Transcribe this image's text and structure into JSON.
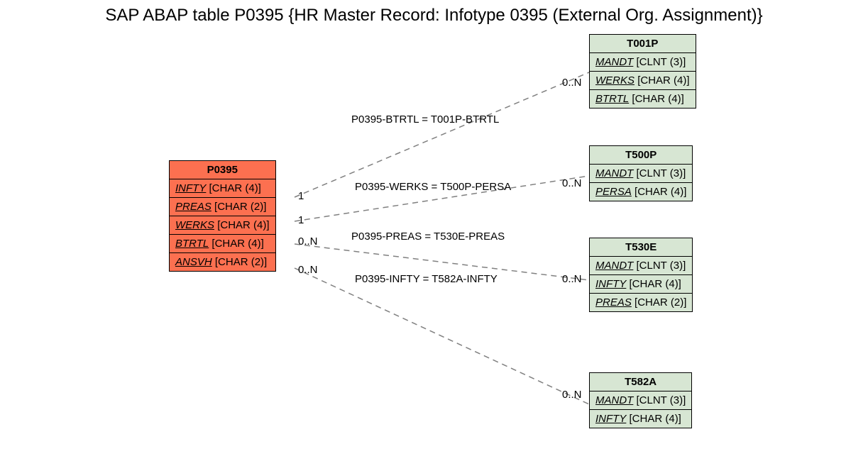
{
  "title": "SAP ABAP table P0395 {HR Master Record: Infotype 0395 (External Org. Assignment)}",
  "main": {
    "name": "P0395",
    "fields": [
      {
        "name": "INFTY",
        "type": "[CHAR (4)]"
      },
      {
        "name": "PREAS",
        "type": "[CHAR (2)]"
      },
      {
        "name": "WERKS",
        "type": "[CHAR (4)]"
      },
      {
        "name": "BTRTL",
        "type": "[CHAR (4)]"
      },
      {
        "name": "ANSVH",
        "type": "[CHAR (2)]"
      }
    ]
  },
  "refs": [
    {
      "name": "T001P",
      "fields": [
        {
          "name": "MANDT",
          "type": "[CLNT (3)]"
        },
        {
          "name": "WERKS",
          "type": "[CHAR (4)]"
        },
        {
          "name": "BTRTL",
          "type": "[CHAR (4)]"
        }
      ]
    },
    {
      "name": "T500P",
      "fields": [
        {
          "name": "MANDT",
          "type": "[CLNT (3)]"
        },
        {
          "name": "PERSA",
          "type": "[CHAR (4)]"
        }
      ]
    },
    {
      "name": "T530E",
      "fields": [
        {
          "name": "MANDT",
          "type": "[CLNT (3)]"
        },
        {
          "name": "INFTY",
          "type": "[CHAR (4)]"
        },
        {
          "name": "PREAS",
          "type": "[CHAR (2)]"
        }
      ]
    },
    {
      "name": "T582A",
      "fields": [
        {
          "name": "MANDT",
          "type": "[CLNT (3)]"
        },
        {
          "name": "INFTY",
          "type": "[CHAR (4)]"
        }
      ]
    }
  ],
  "relations": [
    {
      "label": "P0395-BTRTL = T001P-BTRTL",
      "card_left": "1",
      "card_right": "0..N"
    },
    {
      "label": "P0395-WERKS = T500P-PERSA",
      "card_left": "1",
      "card_right": "0..N"
    },
    {
      "label": "P0395-PREAS = T530E-PREAS",
      "card_left": "0..N",
      "card_right": ""
    },
    {
      "label": "P0395-INFTY = T582A-INFTY",
      "card_left": "0..N",
      "card_right": "0..N"
    }
  ],
  "card_right_t530e": "0..N",
  "card_right_t582a": "0..N"
}
